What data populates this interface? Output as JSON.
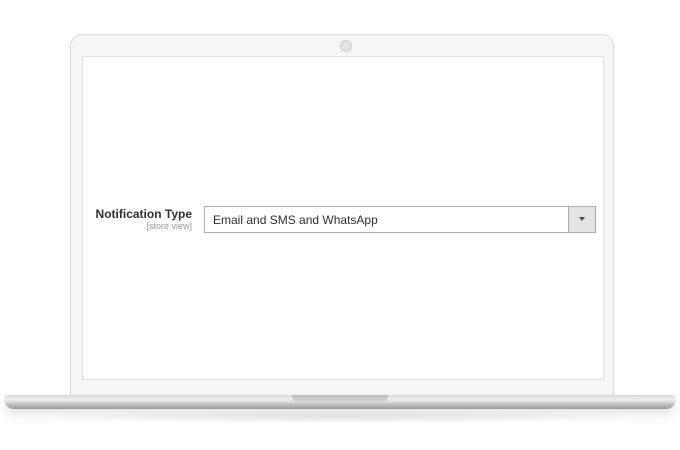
{
  "form": {
    "notification_type": {
      "label": "Notification Type",
      "scope": "[store view]",
      "selected_value": "Email and SMS and WhatsApp"
    }
  },
  "icons": {
    "select_arrow": "chevron-down-icon",
    "camera": "camera-icon"
  },
  "colors": {
    "label_text": "#303030",
    "scope_text": "#999999",
    "select_border": "#adadad",
    "arrow_bg": "#e3e3e3"
  }
}
